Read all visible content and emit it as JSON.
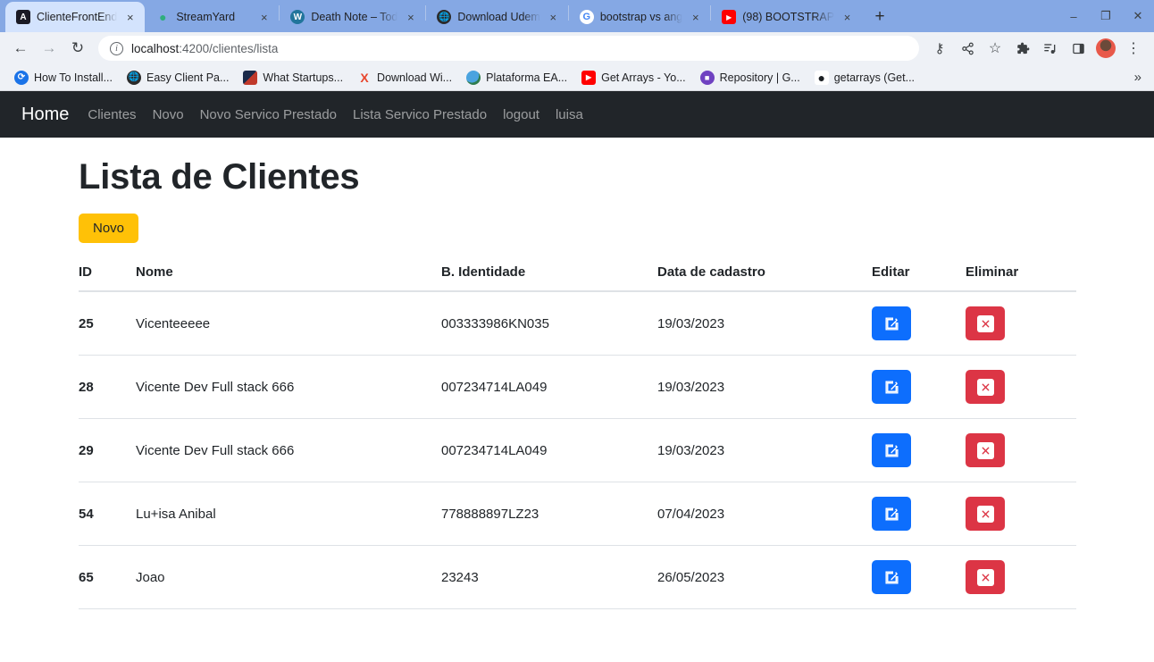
{
  "browser": {
    "tabs": [
      {
        "title": "ClienteFrontEnd",
        "favicon": "angular-icon",
        "active": true
      },
      {
        "title": "StreamYard",
        "favicon": "streamyard-icon",
        "active": false
      },
      {
        "title": "Death Note – Tod",
        "favicon": "wordpress-icon",
        "active": false
      },
      {
        "title": "Download Udem",
        "favicon": "globe-icon",
        "active": false
      },
      {
        "title": "bootstrap vs ang",
        "favicon": "google-icon",
        "active": false
      },
      {
        "title": "(98) BOOTSTRAP",
        "favicon": "youtube-icon",
        "active": false
      }
    ],
    "new_tab_label": "+",
    "tab_close_label": "×",
    "window_controls": {
      "minimize": "–",
      "restore": "❐",
      "close": "✕"
    },
    "toolbar": {
      "back": "←",
      "forward": "→",
      "reload": "↻",
      "site_info": "i",
      "url_host": "localhost",
      "url_rest": ":4200/clientes/lista",
      "key_icon": "⚷",
      "share_icon": "‹",
      "bookmark_star": "☆",
      "extensions_icon": "❖",
      "reading_list_icon": "♫",
      "sidepanel_icon": "▣",
      "menu_icon": "⋮"
    },
    "bookmarks": [
      {
        "label": "How To Install...",
        "icon": "spinner-icon",
        "color": "#1a73e8"
      },
      {
        "label": "Easy Client Pa...",
        "icon": "globe-icon",
        "color": "#2b2b2b"
      },
      {
        "label": "What Startups...",
        "icon": "flag-icon",
        "color": "#c0392b"
      },
      {
        "label": "Download Wi...",
        "icon": "x-icon",
        "color": "#e8452c"
      },
      {
        "label": "Plataforma EA...",
        "icon": "earth-icon",
        "color": "#2f7fbf"
      },
      {
        "label": "Get Arrays - Yo...",
        "icon": "youtube-icon",
        "color": "#ff0000"
      },
      {
        "label": "Repository | G...",
        "icon": "purple-icon",
        "color": "#6f42c1"
      },
      {
        "label": "getarrays (Get...",
        "icon": "github-icon",
        "color": "#1b1f23"
      }
    ],
    "bookmarks_overflow": "»"
  },
  "navbar": {
    "brand": "Home",
    "links": [
      "Clientes",
      "Novo",
      "Novo Servico Prestado",
      "Lista Servico Prestado",
      "logout",
      "luisa"
    ]
  },
  "main": {
    "title": "Lista de Clientes",
    "new_button": "Novo",
    "table": {
      "columns": [
        "ID",
        "Nome",
        "B. Identidade",
        "Data de cadastro",
        "Editar",
        "Eliminar"
      ],
      "rows": [
        {
          "id": "25",
          "nome": "Vicenteeeee",
          "bi": "003333986KN035",
          "data": "19/03/2023"
        },
        {
          "id": "28",
          "nome": "Vicente Dev Full stack 666",
          "bi": "007234714LA049",
          "data": "19/03/2023"
        },
        {
          "id": "29",
          "nome": "Vicente Dev Full stack 666",
          "bi": "007234714LA049",
          "data": "19/03/2023"
        },
        {
          "id": "54",
          "nome": "Lu+isa Anibal",
          "bi": "778888897LZ23",
          "data": "07/04/2023"
        },
        {
          "id": "65",
          "nome": "Joao",
          "bi": "23243",
          "data": "26/05/2023"
        }
      ],
      "edit_icon": "pencil-square-icon",
      "delete_icon": "delete-x-icon"
    }
  },
  "colors": {
    "navbar_bg": "#212529",
    "accent_warning": "#ffc107",
    "accent_primary": "#0d6efd",
    "accent_danger": "#dc3545",
    "tab_active_bg": "#d3e3fd",
    "chrome_bg": "#85a8e4"
  }
}
